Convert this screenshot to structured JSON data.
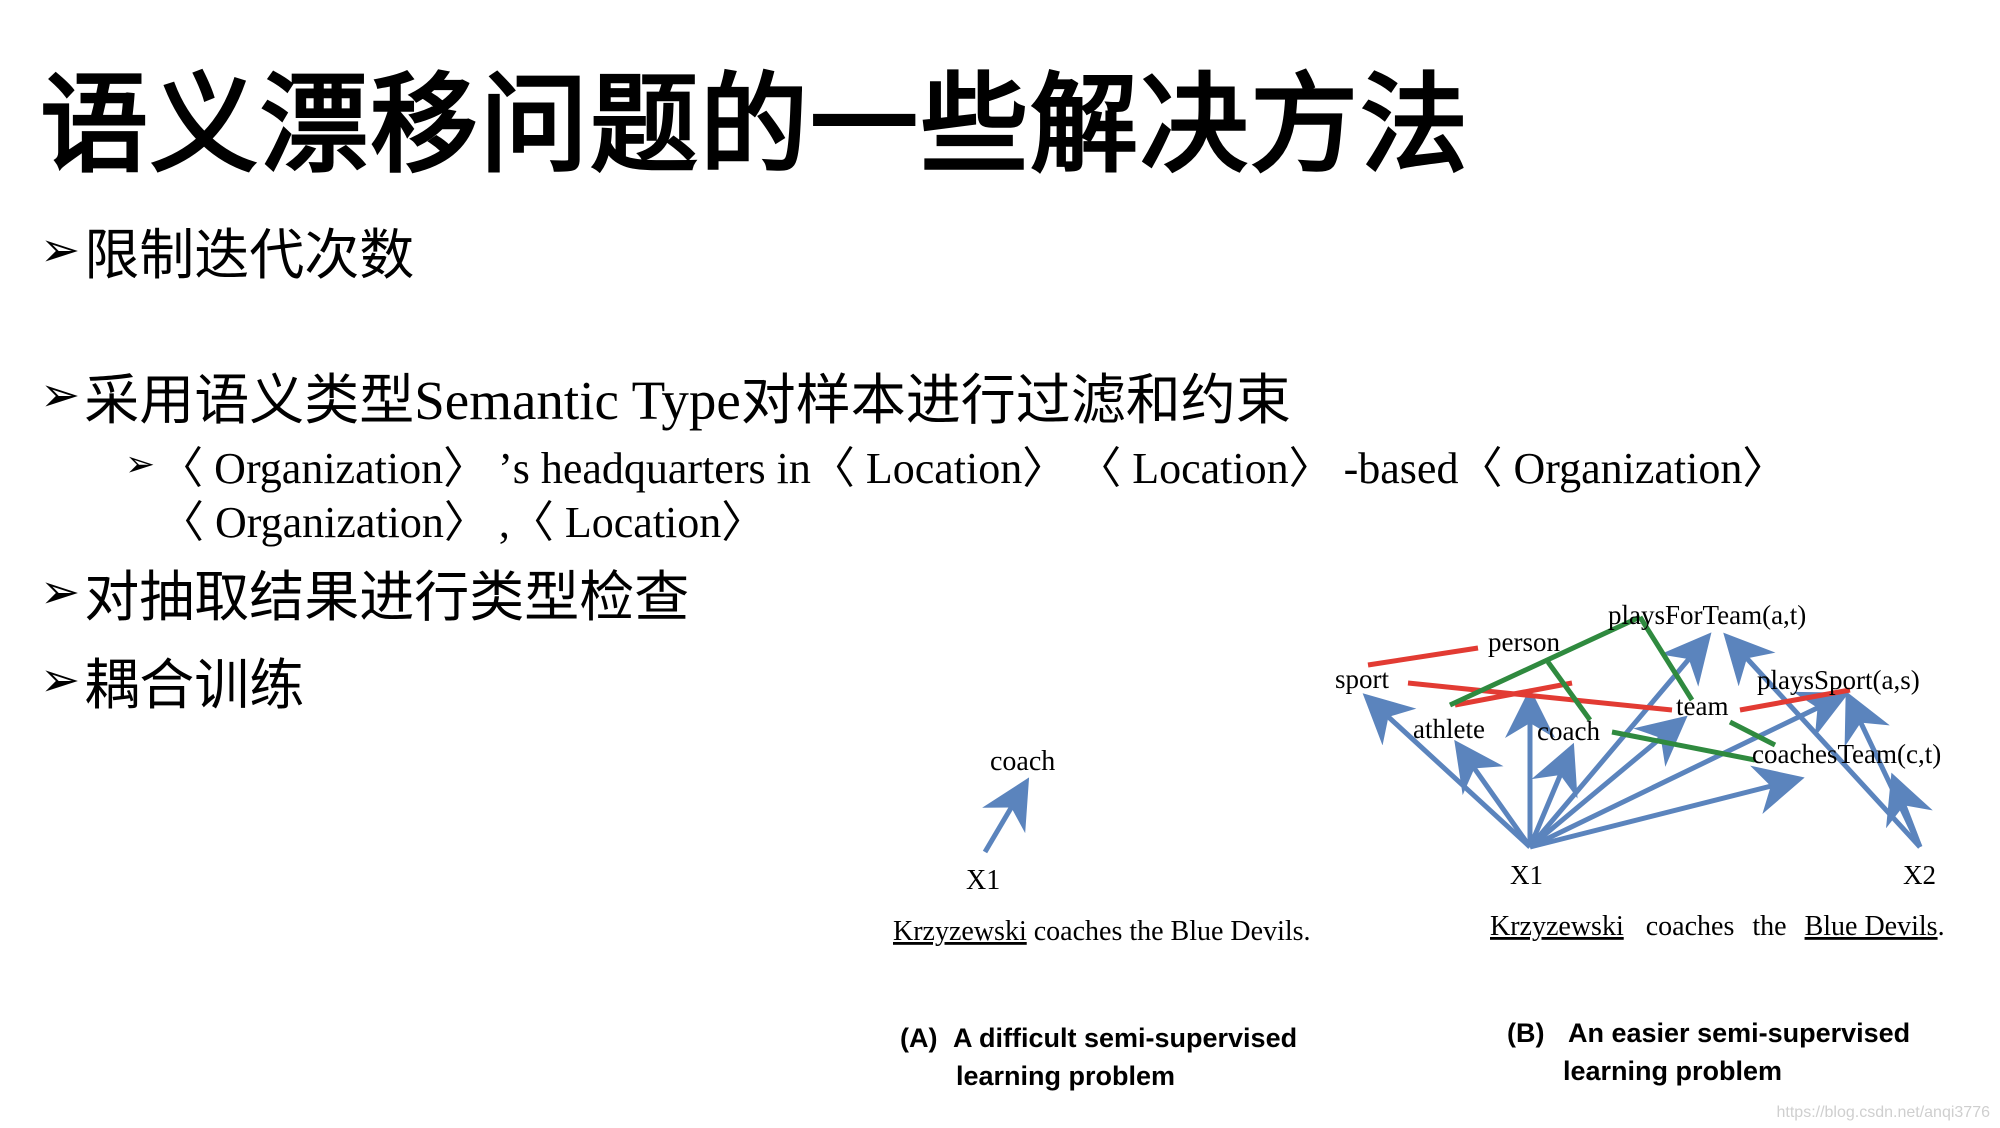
{
  "title": "语义漂移问题的一些解决方法",
  "bullets": [
    {
      "marker": "➢",
      "text": "限制迭代次数"
    },
    {
      "marker": "➢",
      "text": "采用语义类型Semantic Type对样本进行过滤和约束"
    },
    {
      "marker": "➢",
      "text": "对抽取结果进行类型检查"
    },
    {
      "marker": "➢",
      "text": "耦合训练"
    }
  ],
  "sub_bullet": {
    "marker": "➢",
    "line1": "〈 Organization〉 ’s headquarters in〈 Location〉 〈 Location〉 -based〈 Organization〉",
    "line2": "〈 Organization〉 ,〈 Location〉"
  },
  "diagram_a": {
    "node_coach": "coach",
    "node_x1": "X1",
    "sentence_underlined": "Krzyzewski",
    "sentence_rest": " coaches the Blue Devils.",
    "caption_marker": "(A)",
    "caption_line1": "A difficult semi-supervised",
    "caption_line2": "learning problem"
  },
  "diagram_b": {
    "nodes": {
      "person": "person",
      "playsForTeam": "playsForTeam(a,t)",
      "sport": "sport",
      "playsSport": "playsSport(a,s)",
      "team": "team",
      "athlete": "athlete",
      "coach": "coach",
      "coachesTeam": "coachesTeam(c,t)",
      "x1": "X1",
      "x2": "X2"
    },
    "sentence_word1": "Krzyzewski",
    "sentence_word2": "coaches",
    "sentence_word3": "the",
    "sentence_word4": "Blue Devils",
    "sentence_period": ".",
    "caption_marker": "(B)",
    "caption_line1": "An easier semi-supervised",
    "caption_line2": "learning problem"
  },
  "colors": {
    "arrow": "#5b84bd",
    "mutex_edge": "#e23b33",
    "coupling_edge": "#2f8a3f"
  },
  "watermark": "https://blog.csdn.net/anqi3776"
}
